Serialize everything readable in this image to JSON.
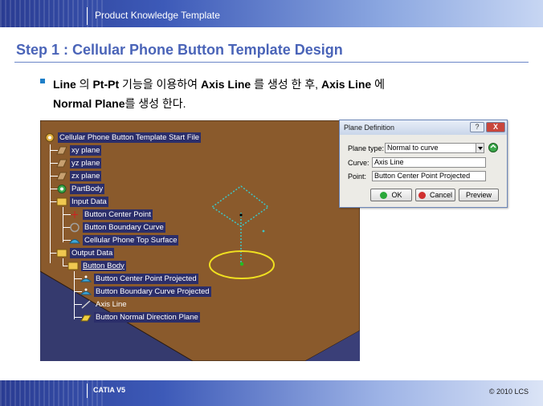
{
  "header": {
    "title": "Product Knowledge Template"
  },
  "slide": {
    "title": "Step 1 : Cellular Phone Button Template Design",
    "bullet": {
      "p1": "Line",
      "p2": " 의 ",
      "p3": "Pt-Pt",
      "p4": " 기능을 이용하여 ",
      "p5": "Axis Line",
      "p6": " 를 생성 한 후, ",
      "p7": "Axis Line",
      "p8": " 에",
      "p9": "Normal Plane",
      "p10": "를 생성 한다."
    }
  },
  "tree": {
    "root": "Cellular Phone Button Template Start File",
    "xy": "xy plane",
    "yz": "yz plane",
    "zx": "zx plane",
    "partbody": "PartBody",
    "input": "Input Data",
    "bcp": "Button Center Point",
    "bbc": "Button Boundary Curve",
    "cpts": "Cellular Phone Top Surface",
    "output": "Output Data",
    "body": "Button Body",
    "bcpp": "Button Center Point Projected",
    "bbcp": "Button Boundary Curve Projected",
    "axis": "Axis Line",
    "bndp": "Button Normal Direction Plane"
  },
  "dialog": {
    "title": "Plane Definition",
    "help": "?",
    "close": "X",
    "plane_type_label": "Plane type:",
    "plane_type_value": "Normal to curve",
    "curve_label": "Curve:",
    "curve_value": "Axis Line",
    "point_label": "Point:",
    "point_value": "Button Center Point Projected",
    "ok": "OK",
    "cancel": "Cancel",
    "preview": "Preview"
  },
  "footer": {
    "left": "CATIA V5",
    "right": "© 2010 LCS"
  },
  "colors": {
    "accent": "#4a64b8",
    "viewport_surface": "#8a5a2c",
    "circle": "#f0e020",
    "dotted": "#3ec6c6"
  }
}
